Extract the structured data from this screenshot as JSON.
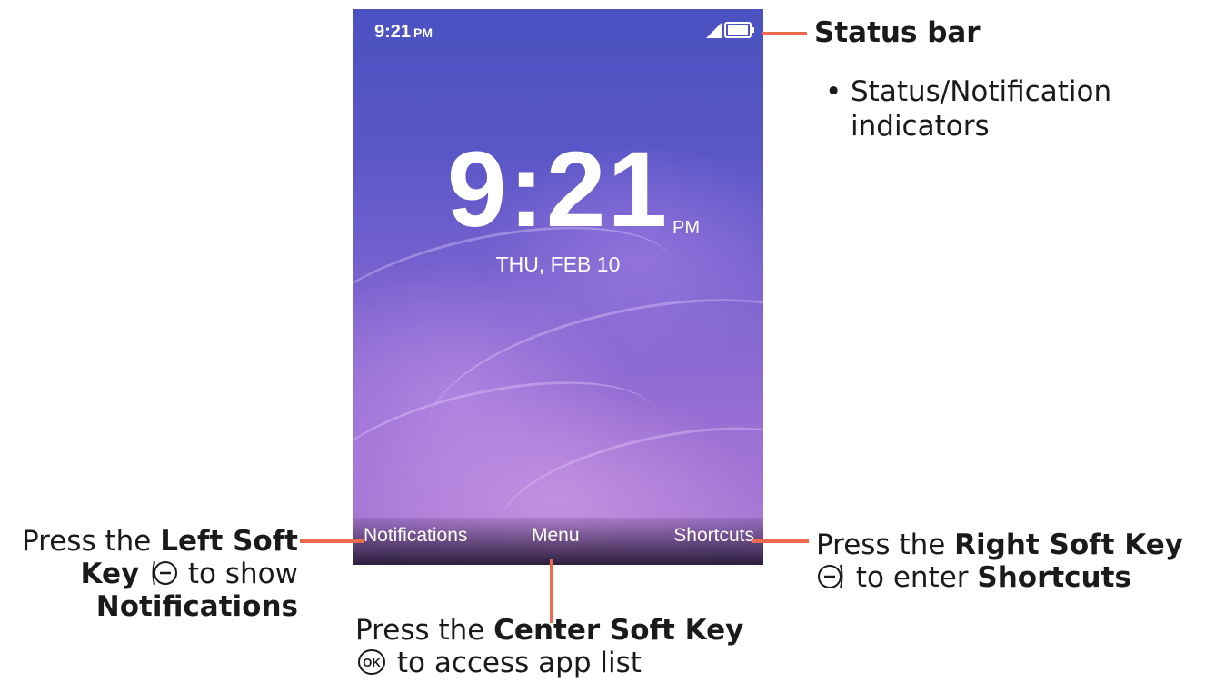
{
  "status_bar": {
    "time": "9:21",
    "ampm": "PM",
    "icons": [
      "signal-icon",
      "battery-icon"
    ]
  },
  "clock": {
    "time": "9:21",
    "ampm": "PM",
    "date": "THU, FEB 10"
  },
  "softkeys": {
    "left": "Notifications",
    "center": "Menu",
    "right": "Shortcuts"
  },
  "annotations": {
    "status_title": "Status bar",
    "status_bullet": "Status/Notification indicators",
    "left": {
      "prefix": "Press the ",
      "bold1": "Left Soft",
      "bold2": "Key",
      "middle": " to show",
      "bold3": "Notifications"
    },
    "right": {
      "prefix": "Press the ",
      "bold1": "Right Soft Key",
      "middle": " to enter ",
      "bold2": "Shortcuts"
    },
    "center": {
      "prefix": "Press the ",
      "bold1": "Center Soft Key",
      "suffix": " to access app list"
    }
  },
  "colors": {
    "callout_line": "#ec6a4e",
    "screen_top": "#4a52c0",
    "screen_bottom": "#b07dd6"
  }
}
